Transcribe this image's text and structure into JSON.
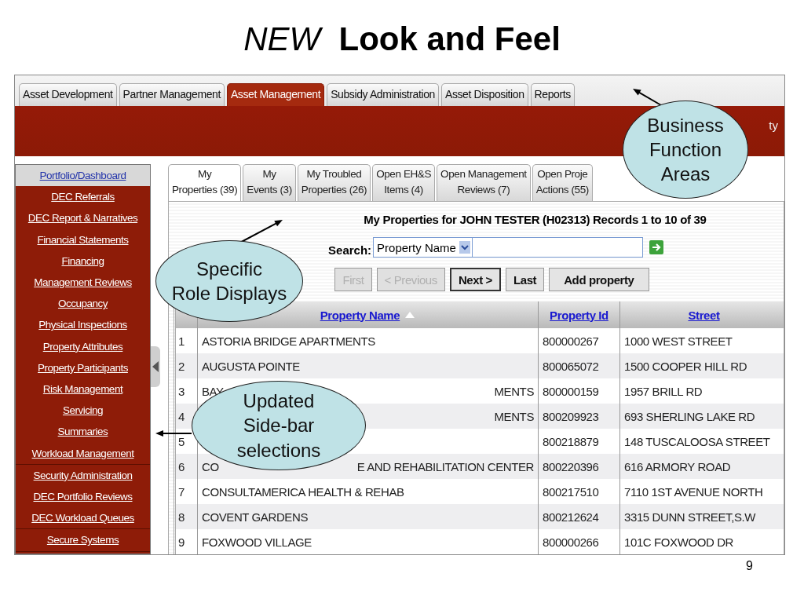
{
  "slide": {
    "title": "*NEW*  **Look and Feel**",
    "page_number": "9"
  },
  "top_tabs": [
    {
      "label": "Asset Development",
      "selected": false
    },
    {
      "label": "Partner Management",
      "selected": false
    },
    {
      "label": "Asset Management",
      "selected": true
    },
    {
      "label": "Subsidy Administration",
      "selected": false
    },
    {
      "label": "Asset Disposition",
      "selected": false
    },
    {
      "label": "Reports",
      "selected": false
    }
  ],
  "header_bar": {
    "text": "ty"
  },
  "sidebar": {
    "groups": [
      {
        "items": [
          {
            "label": "Portfolio/Dashboard",
            "selected": true
          },
          {
            "label": "DEC Referrals",
            "selected": false
          },
          {
            "label": "DEC Report & Narratives",
            "selected": false
          },
          {
            "label": "Financial Statements",
            "selected": false
          },
          {
            "label": "Financing",
            "selected": false
          },
          {
            "label": "Management Reviews",
            "selected": false
          },
          {
            "label": "Occupancy",
            "selected": false
          },
          {
            "label": "Physical Inspections",
            "selected": false
          },
          {
            "label": "Property Attributes",
            "selected": false
          },
          {
            "label": "Property Participants",
            "selected": false
          },
          {
            "label": "Risk Management",
            "selected": false
          },
          {
            "label": "Servicing",
            "selected": false
          },
          {
            "label": "Summaries",
            "selected": false
          },
          {
            "label": "Workload Management",
            "selected": false
          }
        ]
      },
      {
        "items": [
          {
            "label": "Security Administration",
            "selected": false
          },
          {
            "label": "DEC Portfolio Reviews",
            "selected": false
          },
          {
            "label": "DEC Workload Queues",
            "selected": false
          }
        ]
      },
      {
        "items": [
          {
            "label": "Secure Systems",
            "selected": false
          }
        ]
      }
    ]
  },
  "sub_tabs": [
    {
      "lines": [
        "My",
        "Properties (39)"
      ],
      "selected": true
    },
    {
      "lines": [
        "My",
        "Events (3)"
      ],
      "selected": false
    },
    {
      "lines": [
        "My Troubled",
        "Properties (26)"
      ],
      "selected": false
    },
    {
      "lines": [
        "Open EH&S",
        "Items (4)"
      ],
      "selected": false
    },
    {
      "lines": [
        "Open Management",
        "Reviews (7)"
      ],
      "selected": false
    },
    {
      "lines": [
        "Open Proje",
        "Actions (55)"
      ],
      "selected": false
    }
  ],
  "listing": {
    "heading": "My Properties for JOHN TESTER (H02313) Records 1 to 10 of 39",
    "search_label": "Search:",
    "search_by": "Property Name",
    "buttons": [
      {
        "label": "First",
        "disabled": true
      },
      {
        "label": "< Previous",
        "disabled": true
      },
      {
        "label": "Next >",
        "disabled": false
      },
      {
        "label": "Last",
        "disabled": false
      },
      {
        "label": "Add property",
        "disabled": false
      }
    ]
  },
  "table": {
    "columns": [
      {
        "label": "Property Name",
        "sorted": true
      },
      {
        "label": "Property Id",
        "sorted": false
      },
      {
        "label": "Street",
        "sorted": false
      }
    ],
    "rows": [
      {
        "number": "1",
        "name": "ASTORIA BRIDGE APARTMENTS",
        "property_id": "800000267",
        "street": "1000 WEST STREET"
      },
      {
        "number": "2",
        "name": "AUGUSTA POINTE",
        "property_id": "800065072",
        "street": "1500 COOPER HILL RD"
      },
      {
        "number": "3",
        "name": "BAY",
        "name_end": "MENTS",
        "property_id": "800000159",
        "street": "1957 BRILL RD"
      },
      {
        "number": "4",
        "name_end": "MENTS",
        "property_id": "800209923",
        "street": "693 SHERLING LAKE RD"
      },
      {
        "number": "5",
        "property_id": "800218879",
        "street": "148 TUSCALOOSA STREET"
      },
      {
        "number": "6",
        "name": "CO",
        "name_end": "E AND REHABILITATION CENTER",
        "property_id": "800220396",
        "street": "616 ARMORY ROAD"
      },
      {
        "number": "7",
        "name": "CONSULTAMERICA HEALTH & REHAB",
        "property_id": "800217510",
        "street": "7110 1ST AVENUE NORTH"
      },
      {
        "number": "8",
        "name": "COVENT GARDENS",
        "property_id": "800212624",
        "street": "3315 DUNN STREET,S.W"
      },
      {
        "number": "9",
        "name": "FOXWOOD VILLAGE",
        "property_id": "800000266",
        "street": "101C FOXWOOD DR"
      }
    ]
  },
  "callouts": [
    {
      "lines": [
        "Business",
        "Function",
        "Areas"
      ]
    },
    {
      "lines": [
        "Specific",
        "Role Displays"
      ]
    },
    {
      "lines": [
        "Updated",
        "Side-bar",
        "selections"
      ]
    }
  ]
}
